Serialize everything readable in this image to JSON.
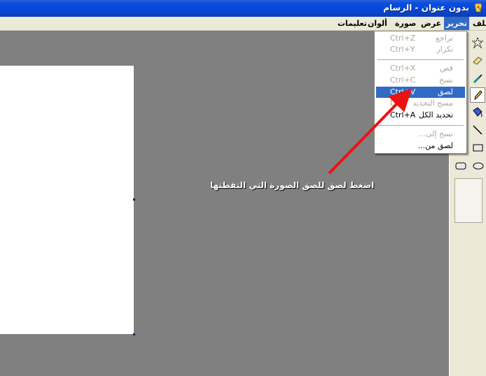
{
  "window": {
    "title": "بدون عنوان - الرسام"
  },
  "menubar": {
    "items": [
      {
        "label": "ملف",
        "active": false
      },
      {
        "label": "تحرير",
        "active": true
      },
      {
        "label": "عرض",
        "active": false
      },
      {
        "label": "صورة",
        "active": false
      },
      {
        "label": "ألوان",
        "active": false
      },
      {
        "label": "تعليمات",
        "active": false
      }
    ]
  },
  "edit_menu": {
    "items": [
      {
        "label": "تراجع",
        "shortcut": "Ctrl+Z",
        "enabled": false
      },
      {
        "label": "تكرار",
        "shortcut": "Ctrl+Y",
        "enabled": false
      },
      {
        "label": "قص",
        "shortcut": "Ctrl+X",
        "enabled": false
      },
      {
        "label": "نسخ",
        "shortcut": "Ctrl+C",
        "enabled": false
      },
      {
        "label": "لصق",
        "shortcut": "Ctrl+V",
        "enabled": true,
        "selected": true
      },
      {
        "label": "مسح التحديد",
        "shortcut": "Del",
        "enabled": false
      },
      {
        "label": "تحديد الكل",
        "shortcut": "Ctrl+A",
        "enabled": true
      },
      {
        "label": "نسخ إلى...",
        "shortcut": "",
        "enabled": false
      },
      {
        "label": "لصق من...",
        "shortcut": "",
        "enabled": true
      }
    ]
  },
  "annotation": {
    "text": "اضغط لصق  للصق الصورة التي التقطتها",
    "color": "#ee1111"
  },
  "toolbox": {
    "tools": [
      "free-form-select-icon",
      "eraser-icon",
      "pick-color-icon",
      "pencil-icon",
      "fill-icon",
      "line-icon",
      "rectangle-icon",
      "rounded-rectangle-icon",
      "ellipse-icon"
    ],
    "selected": "pencil-icon"
  },
  "colors": {
    "accent": "#316ac5",
    "workspace": "#808080",
    "menu_bg": "#ece9d8"
  }
}
